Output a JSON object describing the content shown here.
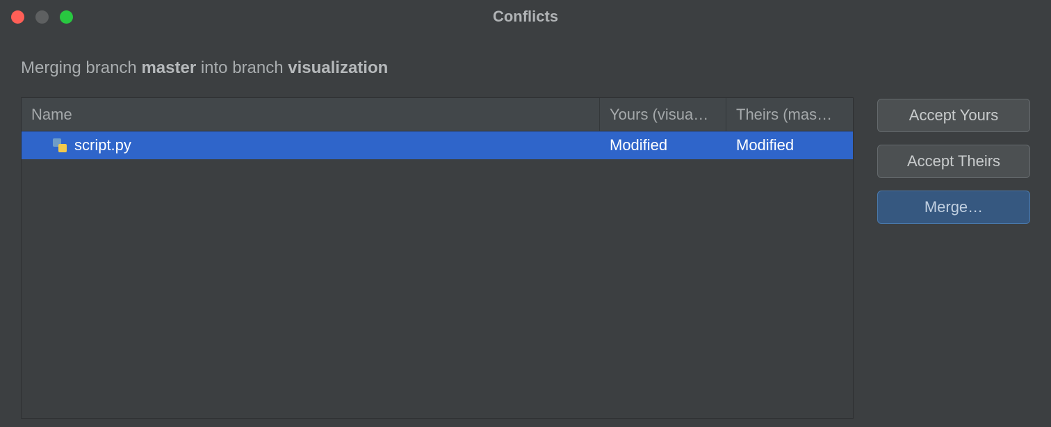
{
  "window": {
    "title": "Conflicts"
  },
  "heading": {
    "prefix1": "Merging branch ",
    "branch_from": "master",
    "middle": " into branch ",
    "branch_into": "visualization"
  },
  "table": {
    "header": {
      "name": "Name",
      "yours": "Yours (visua…",
      "theirs": "Theirs (mas…"
    },
    "rows": [
      {
        "filename": "script.py",
        "yours": "Modified",
        "theirs": "Modified",
        "icon": "python-file-icon"
      }
    ]
  },
  "buttons": {
    "accept_yours": "Accept Yours",
    "accept_theirs": "Accept Theirs",
    "merge": "Merge…"
  }
}
